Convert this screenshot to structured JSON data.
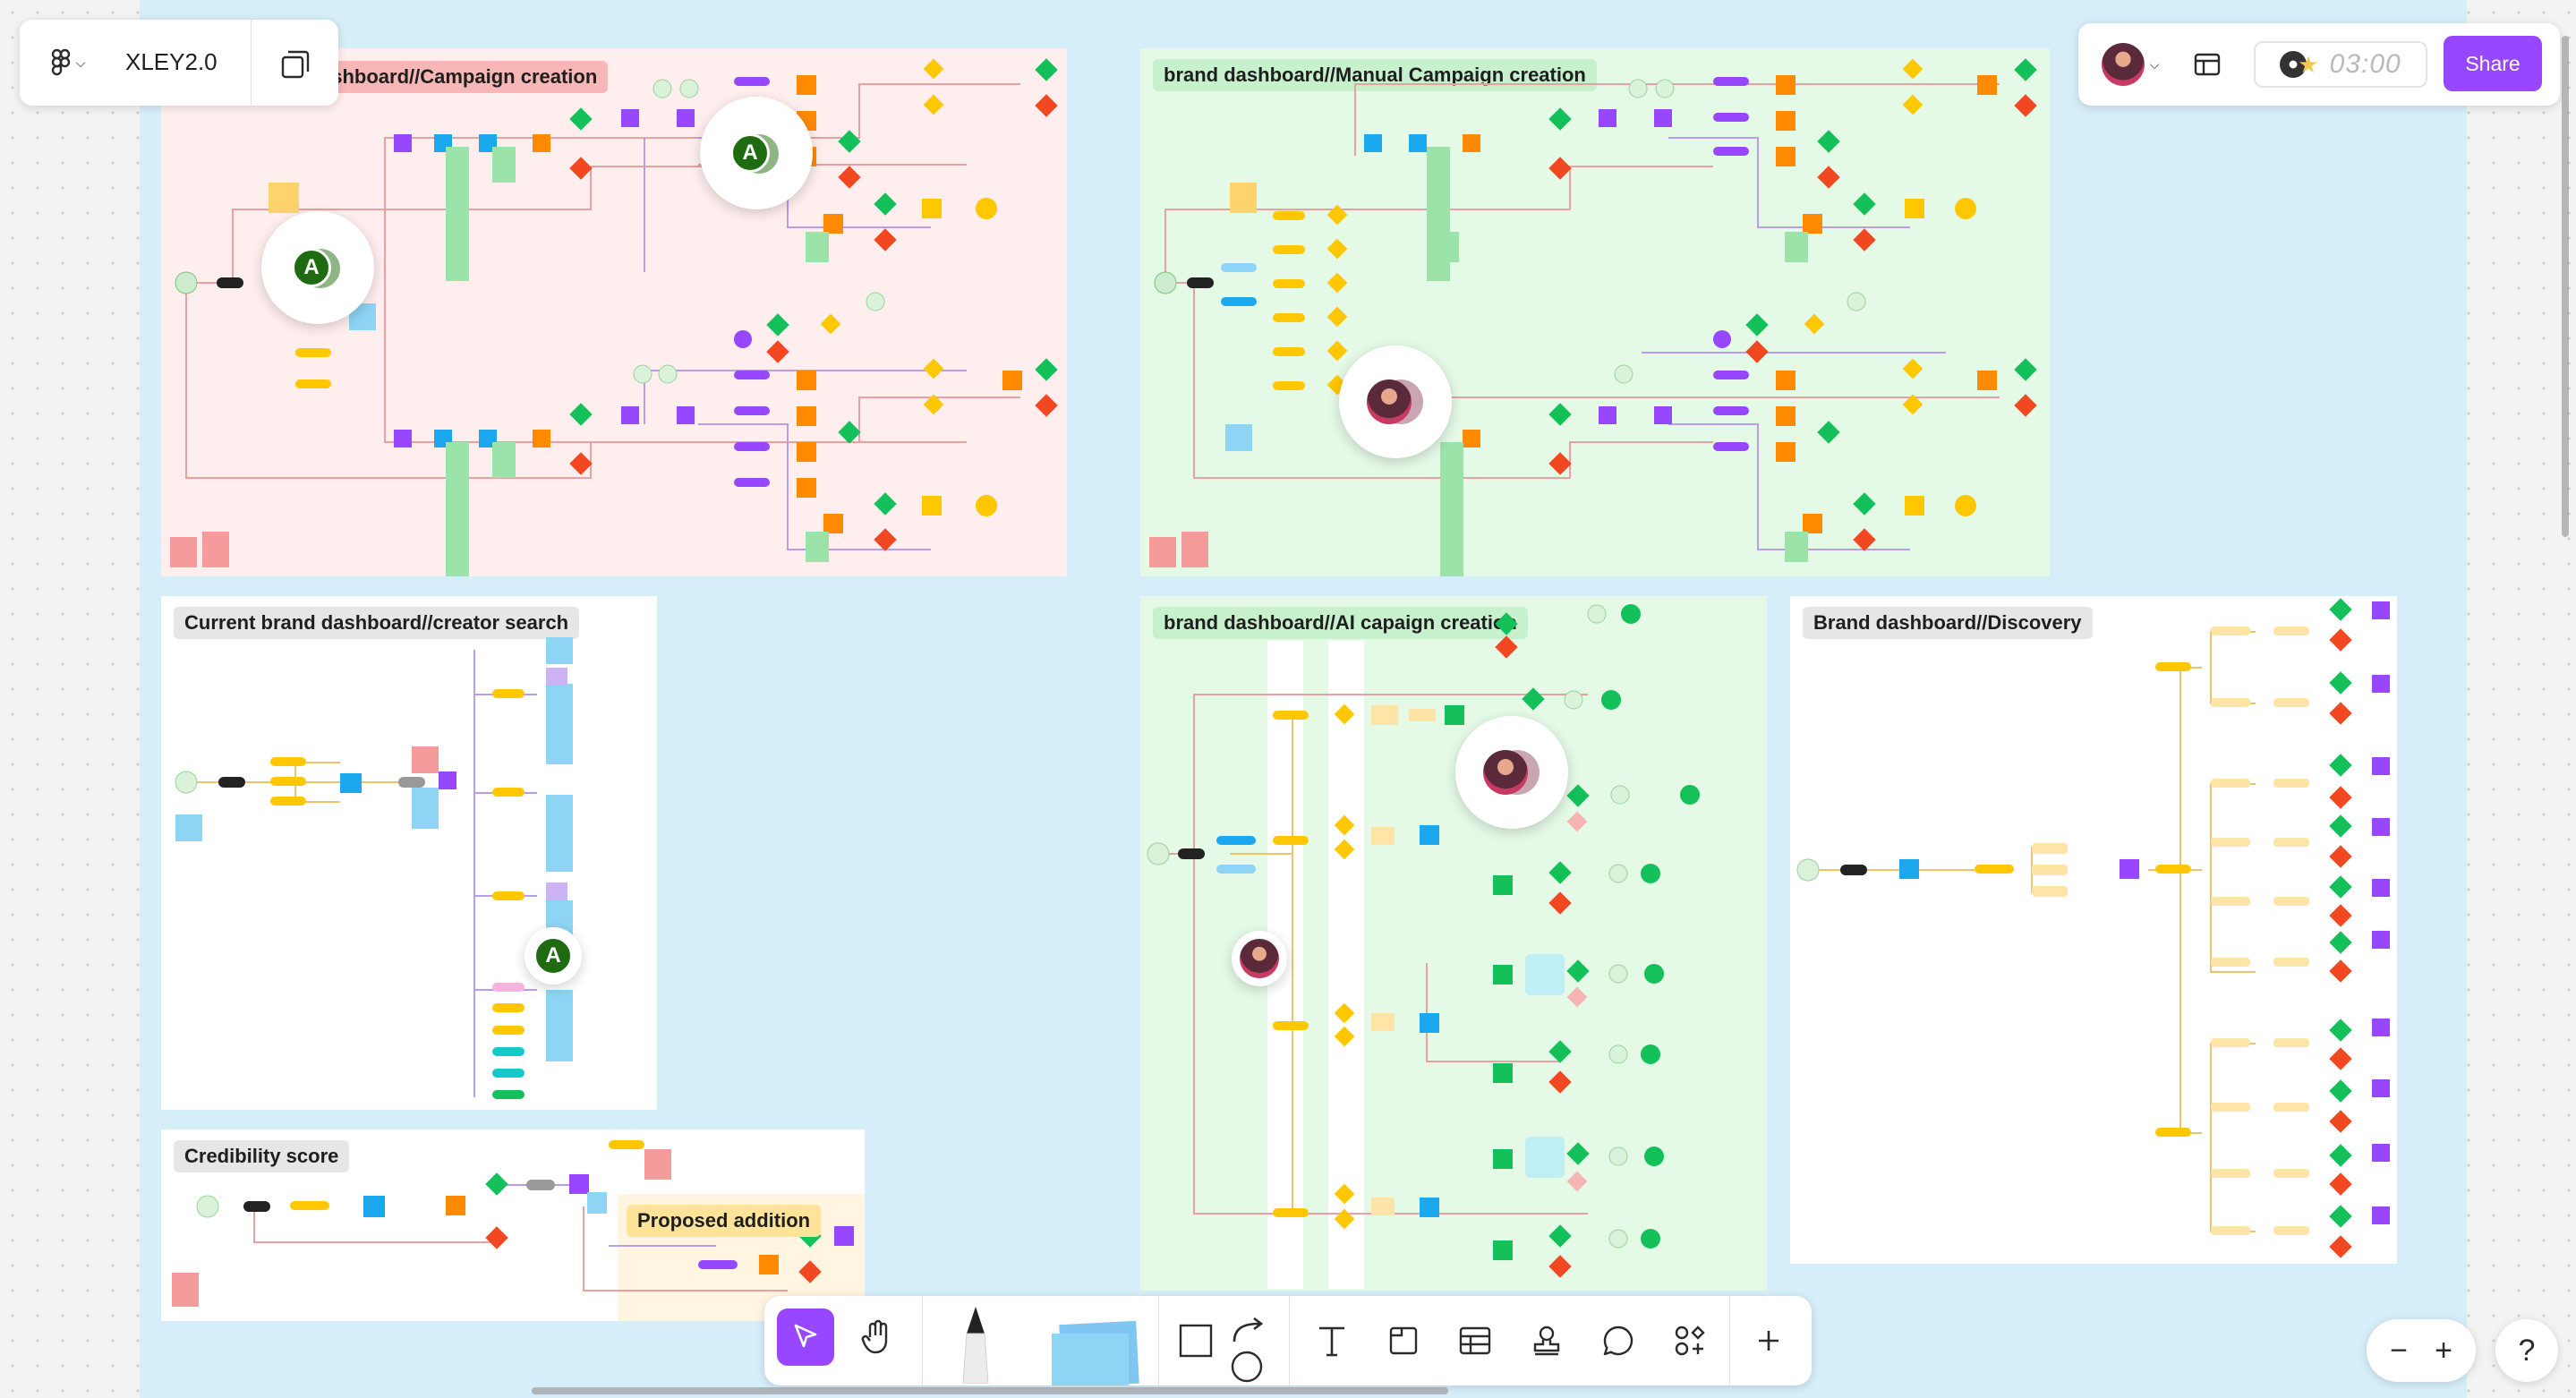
{
  "file": {
    "name": "XLEY2.0"
  },
  "sections": {
    "campaign": {
      "label": "ashboard//Campaign creation"
    },
    "manual": {
      "label": "brand dashboard//Manual Campaign creation"
    },
    "creator_search": {
      "label": "Current brand dashboard//creator search"
    },
    "ai": {
      "label": "brand dashboard//AI capaign creation"
    },
    "discovery": {
      "label": "Brand dashboard//Discovery"
    },
    "credibility": {
      "label": "Credibility score"
    },
    "proposed": {
      "label": "Proposed addition"
    }
  },
  "collaborators": {
    "avatar_letter": "A"
  },
  "header": {
    "timer": "03:00",
    "share_label": "Share"
  },
  "zoom": {
    "minus": "−",
    "plus": "+",
    "help": "?"
  },
  "toolbar": {
    "icons": [
      "select-icon",
      "hand-icon",
      "pen-icon",
      "sticky-note-icon",
      "shape-icon",
      "connector-icon",
      "text-icon",
      "section-icon",
      "table-icon",
      "stamp-icon",
      "comment-icon",
      "widgets-icon",
      "plus-icon"
    ]
  },
  "colors": {
    "accent": "#9747ff",
    "canvas": "#d6eefa"
  }
}
